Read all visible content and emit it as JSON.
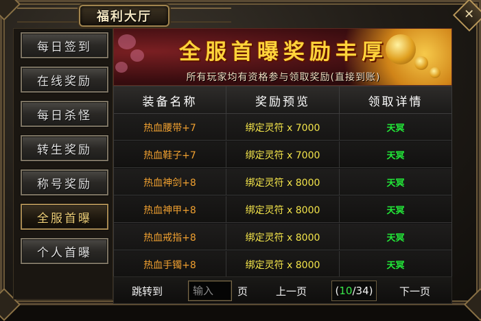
{
  "window": {
    "title": "福利大厅",
    "close_glyph": "✕"
  },
  "sidebar": {
    "items": [
      {
        "label": "每日签到",
        "active": false
      },
      {
        "label": "在线奖励",
        "active": false
      },
      {
        "label": "每日杀怪",
        "active": false
      },
      {
        "label": "转生奖励",
        "active": false
      },
      {
        "label": "称号奖励",
        "active": false
      },
      {
        "label": "全服首曝",
        "active": true
      },
      {
        "label": "个人首曝",
        "active": false
      }
    ]
  },
  "banner": {
    "title": "全服首曝奖励丰厚",
    "subtitle": "所有玩家均有资格参与领取奖励(直接到账)"
  },
  "table": {
    "headers": [
      "装备名称",
      "奖励预览",
      "领取详情"
    ],
    "rows": [
      {
        "item": "热血腰带+7",
        "reward": "绑定灵符 x 7000",
        "detail": "天冥"
      },
      {
        "item": "热血鞋子+7",
        "reward": "绑定灵符 x 7000",
        "detail": "天冥"
      },
      {
        "item": "热血神剑+8",
        "reward": "绑定灵符 x 8000",
        "detail": "天冥"
      },
      {
        "item": "热血神甲+8",
        "reward": "绑定灵符 x 8000",
        "detail": "天冥"
      },
      {
        "item": "热血戒指+8",
        "reward": "绑定灵符 x 8000",
        "detail": "天冥"
      },
      {
        "item": "热血手镯+8",
        "reward": "绑定灵符 x 8000",
        "detail": "天冥"
      }
    ]
  },
  "pager": {
    "goto_label": "跳转到",
    "input_placeholder": "输入",
    "page_unit": "页",
    "prev_label": "上一页",
    "next_label": "下一页",
    "current_page": "10",
    "total_pages": "34",
    "open_paren": "(",
    "separator": "/",
    "close_paren": ")"
  },
  "colors": {
    "item_name": "#f0a030",
    "reward": "#f3e44a",
    "detail": "#22e838",
    "banner_title": "#ffd43b",
    "current_page": "#39e84a"
  }
}
